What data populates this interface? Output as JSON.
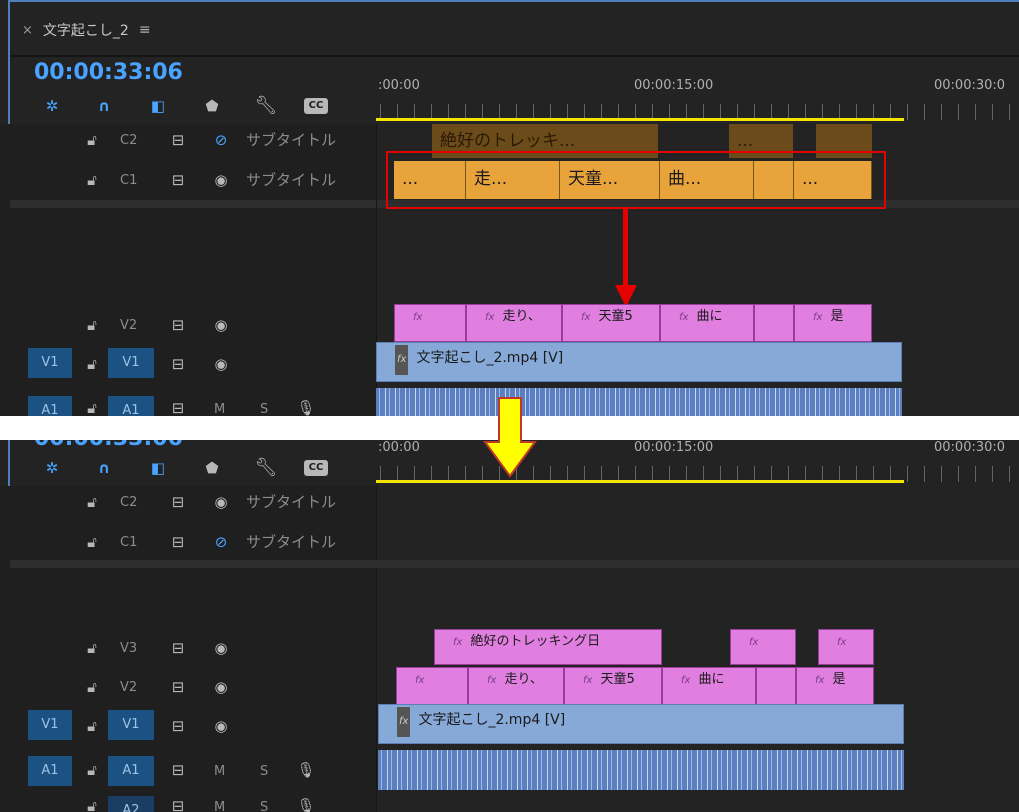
{
  "colors": {
    "accent_blue": "#4aa3ff",
    "subtitle_orange": "#e8a33b",
    "fx_pink": "#e07fe0",
    "video_blue": "#86a9d8",
    "highlight_red": "#e60000",
    "arrow_yellow": "#ffff00"
  },
  "sequence": {
    "tab_title": "文字起こし_2",
    "menu_icon": "≡",
    "close_icon": "×",
    "timecode": "00:00:33:06"
  },
  "ruler": {
    "t0": ":00:00",
    "t15": "00:00:15:00",
    "t30": "00:00:30:0"
  },
  "toolbar_icons": [
    "snap-icon",
    "magnet-icon",
    "marker-in-icon",
    "marker-icon",
    "wrench-icon",
    "cc-icon"
  ],
  "top": {
    "tracks": {
      "c2": {
        "name": "C2",
        "label": "サブタイトル"
      },
      "c1": {
        "name": "C1",
        "label": "サブタイトル"
      },
      "v2": {
        "name": "V2"
      },
      "v1": {
        "name": "V1",
        "target": "V1"
      },
      "a1": {
        "name": "A1",
        "target": "A1",
        "m": "M",
        "s": "S"
      }
    },
    "c2_clips": [
      "絶好のトレッキ...",
      "...",
      ""
    ],
    "c1_clips": [
      "...",
      "走...",
      "天童...",
      "曲...",
      "",
      "..."
    ],
    "v2_clips": [
      "走り、",
      "天童5",
      "曲に",
      "是"
    ],
    "video_clip": "文字起こし_2.mp4 [V]"
  },
  "bottom": {
    "tracks": {
      "c2": {
        "name": "C2",
        "label": "サブタイトル"
      },
      "c1": {
        "name": "C1",
        "label": "サブタイトル"
      },
      "v3": {
        "name": "V3"
      },
      "v2": {
        "name": "V2"
      },
      "v1": {
        "name": "V1",
        "target": "V1"
      },
      "a1": {
        "name": "A1",
        "target": "A1",
        "m": "M",
        "s": "S"
      },
      "a2": {
        "name": "A2",
        "m": "M",
        "s": "S"
      }
    },
    "v3_clips": [
      "絶好のトレッキング日"
    ],
    "v2_clips": [
      "走り、",
      "天童5",
      "曲に",
      "是"
    ],
    "video_clip": "文字起こし_2.mp4 [V]"
  },
  "fx_label": "fx"
}
